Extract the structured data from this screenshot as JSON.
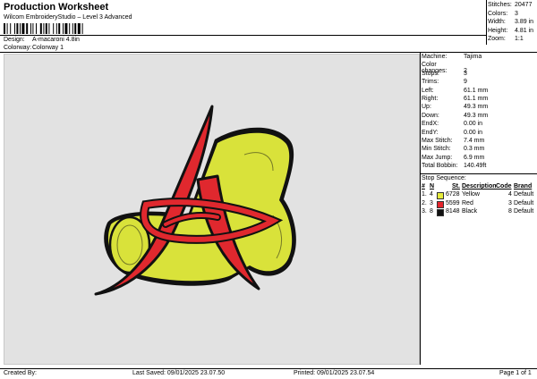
{
  "header": {
    "title": "Production Worksheet",
    "subtitle": "Wilcom EmbroideryStudio – Level 3 Advanced"
  },
  "design_info": {
    "design_label": "Design:",
    "design_value": "A-macaroni 4.8in",
    "colorway_label": "Colorway:",
    "colorway_value": "Colorway 1"
  },
  "summary": [
    {
      "label": "Stitches:",
      "value": "20477"
    },
    {
      "label": "Colors:",
      "value": "3"
    },
    {
      "label": "Width:",
      "value": "3.89 in"
    },
    {
      "label": "Height:",
      "value": "4.81 in"
    },
    {
      "label": "Zoom:",
      "value": "1:1"
    }
  ],
  "machine_info": [
    {
      "label": "Machine:",
      "value": "Tajima"
    },
    {
      "label": "Color changes:",
      "value": "2"
    },
    {
      "label": "Stops:",
      "value": "3"
    },
    {
      "label": "Trims:",
      "value": "9"
    },
    {
      "label": "Left:",
      "value": "61.1 mm"
    },
    {
      "label": "Right:",
      "value": "61.1 mm"
    },
    {
      "label": "Up:",
      "value": "49.3 mm"
    },
    {
      "label": "Down:",
      "value": "49.3 mm"
    },
    {
      "label": "EndX:",
      "value": "0.00 in"
    },
    {
      "label": "EndY:",
      "value": "0.00 in"
    },
    {
      "label": "Max Stitch:",
      "value": "7.4 mm"
    },
    {
      "label": "Min Stitch:",
      "value": "0.3 mm"
    },
    {
      "label": "Max Jump:",
      "value": "6.9 mm"
    },
    {
      "label": "Total Bobbin:",
      "value": "140.49ft"
    }
  ],
  "stop_sequence": {
    "heading": "Stop Sequence:",
    "headers": {
      "num": "#",
      "n": "N",
      "st": "St.",
      "description": "Description",
      "code": "Code",
      "brand": "Brand"
    },
    "rows": [
      {
        "num": "1.",
        "n": "4",
        "st": "6728",
        "description": "Yellow",
        "code": "4",
        "brand": "Default",
        "color": "#e6ec3c"
      },
      {
        "num": "2.",
        "n": "3",
        "st": "5599",
        "description": "Red",
        "code": "3",
        "brand": "Default",
        "color": "#e5242b"
      },
      {
        "num": "3.",
        "n": "8",
        "st": "8148",
        "description": "Black",
        "code": "8",
        "brand": "Default",
        "color": "#111111"
      }
    ]
  },
  "footer": {
    "created_by": "Created By:",
    "last_saved": "Last Saved: 09/01/2025 23.07.50",
    "printed": "Printed: 09/01/2025 23.07.54",
    "page": "Page 1 of 1"
  },
  "colors": {
    "yellow": "#d9e23a",
    "red": "#e0282e",
    "black": "#111111",
    "canvas": "#e2e2e2"
  }
}
